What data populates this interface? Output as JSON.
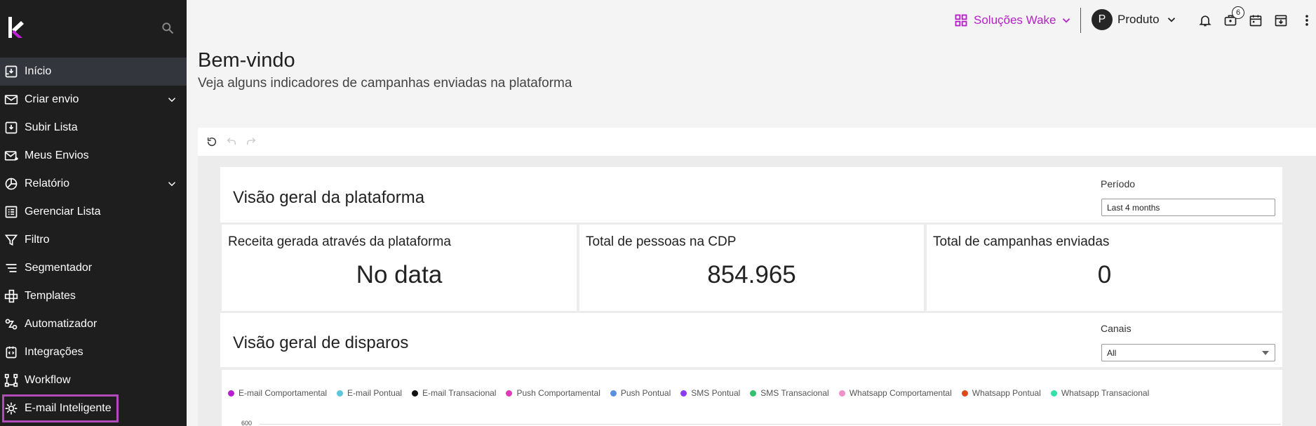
{
  "sidebar": {
    "items": [
      {
        "label": "Início",
        "icon": "inbox-download-icon"
      },
      {
        "label": "Criar envio",
        "icon": "mail-icon"
      },
      {
        "label": "Subir Lista",
        "icon": "upload-list-icon"
      },
      {
        "label": "Meus Envios",
        "icon": "mail-sent-icon"
      },
      {
        "label": "Relatório",
        "icon": "pie-chart-icon"
      },
      {
        "label": "Gerenciar Lista",
        "icon": "list-icon"
      },
      {
        "label": "Filtro",
        "icon": "filter-icon"
      },
      {
        "label": "Segmentador",
        "icon": "segment-icon"
      },
      {
        "label": "Templates",
        "icon": "templates-icon"
      },
      {
        "label": "Automatizador",
        "icon": "automation-icon"
      },
      {
        "label": "Integrações",
        "icon": "integration-icon"
      },
      {
        "label": "Workflow",
        "icon": "workflow-icon"
      },
      {
        "label": "E-mail Inteligente",
        "icon": "smart-mail-icon"
      }
    ]
  },
  "topbar": {
    "brand_label": "Soluções Wake",
    "user_initial": "P",
    "user_label": "Produto",
    "badge_count": "6"
  },
  "header": {
    "title": "Bem-vindo",
    "subtitle": "Veja alguns indicadores de campanhas enviadas na plataforma"
  },
  "dashboard": {
    "platform_title": "Visão geral da plataforma",
    "period_label": "Período",
    "period_value": "Last 4 months",
    "kpis": [
      {
        "title": "Receita gerada através da plataforma",
        "value": "No data"
      },
      {
        "title": "Total de pessoas na CDP",
        "value": "854.965"
      },
      {
        "title": "Total de campanhas enviadas",
        "value": "0"
      }
    ],
    "dispatch_title": "Visão geral de disparos",
    "channels_label": "Canais",
    "channels_value": "All",
    "y_tick_top": "600"
  },
  "chart_data": {
    "type": "line",
    "series": [
      {
        "name": "E-mail Comportamental",
        "color": "#b61fd0",
        "values": []
      },
      {
        "name": "E-mail Pontual",
        "color": "#5bc6dc",
        "values": []
      },
      {
        "name": "E-mail Transacional",
        "color": "#111111",
        "values": []
      },
      {
        "name": "Push Comportamental",
        "color": "#e03ab8",
        "values": []
      },
      {
        "name": "Push Pontual",
        "color": "#5b8fe0",
        "values": []
      },
      {
        "name": "SMS Pontual",
        "color": "#8a3cf0",
        "values": []
      },
      {
        "name": "SMS Transacional",
        "color": "#33c26b",
        "values": []
      },
      {
        "name": "Whatsapp Comportamental",
        "color": "#f08fc8",
        "values": []
      },
      {
        "name": "Whatsapp Pontual",
        "color": "#e0481a",
        "values": []
      },
      {
        "name": "Whatsapp Transacional",
        "color": "#33e0a8",
        "values": []
      }
    ],
    "ylim_max_visible": 600,
    "legend_position": "top"
  }
}
